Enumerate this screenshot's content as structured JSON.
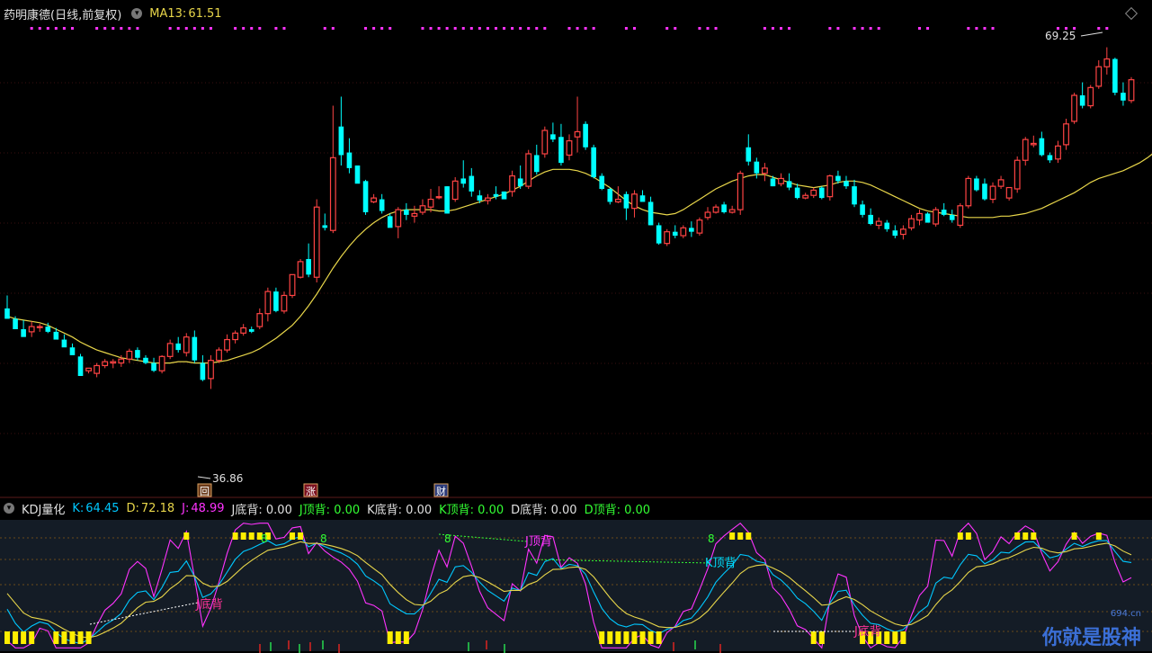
{
  "main_header": {
    "title": "药明康德(日线,前复权)",
    "ma_label": "MA13:",
    "ma_value": "61.51"
  },
  "indicator_header": {
    "name": "KDJ量化",
    "k_label": "K:",
    "k_value": "64.45",
    "d_label": "D:",
    "d_value": "72.18",
    "j_label": "J:",
    "j_value": "48.99",
    "j_bottom": "J底背: 0.00",
    "j_top": "J顶背: 0.00",
    "k_bottom": "K底背: 0.00",
    "k_top": "K顶背: 0.00",
    "d_bottom": "D底背: 0.00",
    "d_top": "D顶背: 0.00"
  },
  "annotations": {
    "high": "69.25",
    "low": "36.86",
    "badge_hui": "回",
    "badge_zhang": "涨",
    "badge_cai": "财",
    "j_bottom_div": "J底背",
    "j_top_div": "J顶背",
    "k_top_div": "K顶背",
    "j_bottom_div2": "J底背",
    "sig": "8"
  },
  "watermark": {
    "text": "你就是股神",
    "site": "694.cn"
  },
  "colors": {
    "up": "#ff4444",
    "down": "#00ffff",
    "ma": "#e8d64a",
    "k": "#00c8ff",
    "d": "#e8d64a",
    "j": "#ff33ff",
    "bg": "#000000"
  },
  "chart_data": [
    {
      "type": "candlestick",
      "title": "药明康德(日线,前复权)",
      "series_name": "MA13",
      "ylim": [
        35,
        71
      ],
      "candles": [
        [
          49.2,
          50.2,
          48.6,
          48.4
        ],
        [
          48.4,
          48.6,
          47.8,
          47.6
        ],
        [
          47.6,
          48.3,
          47.2,
          47.0
        ],
        [
          47.4,
          48.2,
          47.0,
          47.8
        ],
        [
          47.8,
          48.0,
          47.4,
          47.8
        ],
        [
          47.8,
          48.1,
          47.3,
          47.4
        ],
        [
          47.4,
          47.7,
          47.0,
          46.8
        ],
        [
          46.8,
          47.2,
          46.5,
          46.2
        ],
        [
          46.2,
          46.5,
          45.8,
          45.6
        ],
        [
          45.5,
          45.7,
          44.2,
          44.0
        ],
        [
          44.4,
          44.5,
          44.2,
          44.6
        ],
        [
          44.2,
          45.0,
          43.9,
          44.8
        ],
        [
          44.8,
          45.3,
          44.6,
          45.1
        ],
        [
          45.0,
          45.3,
          44.6,
          45.1
        ],
        [
          45.0,
          45.6,
          44.7,
          45.3
        ],
        [
          45.3,
          46.1,
          45.0,
          45.9
        ],
        [
          46.0,
          46.2,
          45.2,
          45.4
        ],
        [
          45.4,
          45.6,
          44.9,
          45.0
        ],
        [
          45.0,
          45.4,
          44.3,
          44.4
        ],
        [
          44.4,
          45.6,
          44.2,
          45.5
        ],
        [
          45.5,
          46.8,
          45.3,
          46.5
        ],
        [
          46.5,
          47.0,
          45.8,
          46.0
        ],
        [
          45.8,
          47.3,
          45.5,
          47.0
        ],
        [
          47.0,
          47.5,
          45.0,
          45.2
        ],
        [
          45.0,
          45.6,
          43.6,
          43.7
        ],
        [
          43.8,
          45.6,
          43.0,
          45.2
        ],
        [
          45.2,
          46.2,
          45.0,
          46.0
        ],
        [
          46.0,
          47.2,
          45.8,
          46.8
        ],
        [
          46.8,
          47.5,
          46.5,
          47.3
        ],
        [
          47.3,
          48.0,
          47.1,
          47.7
        ],
        [
          47.6,
          47.8,
          47.3,
          47.4
        ],
        [
          47.8,
          49.2,
          47.6,
          48.8
        ],
        [
          48.8,
          50.8,
          48.2,
          50.5
        ],
        [
          50.5,
          50.8,
          48.9,
          49.0
        ],
        [
          49.0,
          50.5,
          48.8,
          50.2
        ],
        [
          50.2,
          51.8,
          50.0,
          51.8
        ],
        [
          51.6,
          53.0,
          51.5,
          52.8
        ],
        [
          53.0,
          54.2,
          51.6,
          51.8
        ],
        [
          51.6,
          57.6,
          51.2,
          57.0
        ],
        [
          55.6,
          56.5,
          55.2,
          55.4
        ],
        [
          55.2,
          64.8,
          55.0,
          60.8
        ],
        [
          63.2,
          65.5,
          60.2,
          61.0
        ],
        [
          61.2,
          62.3,
          59.6,
          60.0
        ],
        [
          60.2,
          60.2,
          59.6,
          58.8
        ],
        [
          59.0,
          59.1,
          56.4,
          56.6
        ],
        [
          57.4,
          58.0,
          57.3,
          57.7
        ],
        [
          57.6,
          58.0,
          56.5,
          56.7
        ],
        [
          56.3,
          56.5,
          55.6,
          55.4
        ],
        [
          55.5,
          57.0,
          54.6,
          56.8
        ],
        [
          56.8,
          57.3,
          56.0,
          56.4
        ],
        [
          56.3,
          57.1,
          55.8,
          56.5
        ],
        [
          56.6,
          57.6,
          56.4,
          57.1
        ],
        [
          57.0,
          58.4,
          56.6,
          57.6
        ],
        [
          57.8,
          58.6,
          57.6,
          57.8
        ],
        [
          58.6,
          58.6,
          56.5,
          56.5
        ],
        [
          57.6,
          59.3,
          57.4,
          59.0
        ],
        [
          59.2,
          60.6,
          58.5,
          58.8
        ],
        [
          59.4,
          60.0,
          57.8,
          58.2
        ],
        [
          57.9,
          58.3,
          57.3,
          57.5
        ],
        [
          57.5,
          58.0,
          57.2,
          57.7
        ],
        [
          58.0,
          58.6,
          57.6,
          57.8
        ],
        [
          58.2,
          58.2,
          57.6,
          57.6
        ],
        [
          58.2,
          59.8,
          57.8,
          59.4
        ],
        [
          59.2,
          60.2,
          58.4,
          58.6
        ],
        [
          58.6,
          61.4,
          58.4,
          61.1
        ],
        [
          61.0,
          61.8,
          59.5,
          59.7
        ],
        [
          61.1,
          63.2,
          60.8,
          62.9
        ],
        [
          62.6,
          63.5,
          62.0,
          62.2
        ],
        [
          62.4,
          63.4,
          60.2,
          60.4
        ],
        [
          61.0,
          62.6,
          60.6,
          62.1
        ],
        [
          62.4,
          65.5,
          61.2,
          62.8
        ],
        [
          63.4,
          63.6,
          61.4,
          61.6
        ],
        [
          61.6,
          61.8,
          59.2,
          59.3
        ],
        [
          59.4,
          59.6,
          58.3,
          58.4
        ],
        [
          58.4,
          58.5,
          57.2,
          57.4
        ],
        [
          57.4,
          58.6,
          57.3,
          57.6
        ],
        [
          58.0,
          58.2,
          56.0,
          56.9
        ],
        [
          56.9,
          58.3,
          56.2,
          58.0
        ],
        [
          57.9,
          58.3,
          57.6,
          57.4
        ],
        [
          57.4,
          57.8,
          55.6,
          55.6
        ],
        [
          55.6,
          55.8,
          54.1,
          54.2
        ],
        [
          54.2,
          55.3,
          54.0,
          55.1
        ],
        [
          55.1,
          55.6,
          54.6,
          54.8
        ],
        [
          54.8,
          55.6,
          54.6,
          55.4
        ],
        [
          55.4,
          55.9,
          54.7,
          55.1
        ],
        [
          55.0,
          56.2,
          54.8,
          56.0
        ],
        [
          56.2,
          57.0,
          56.0,
          56.6
        ],
        [
          56.6,
          57.2,
          56.5,
          57.0
        ],
        [
          57.2,
          57.4,
          56.5,
          56.6
        ],
        [
          56.6,
          57.1,
          56.5,
          56.8
        ],
        [
          56.8,
          59.8,
          56.4,
          59.6
        ],
        [
          61.6,
          62.6,
          60.2,
          60.5
        ],
        [
          60.5,
          60.8,
          59.2,
          59.6
        ],
        [
          59.6,
          60.4,
          59.0,
          60.0
        ],
        [
          59.2,
          59.4,
          58.6,
          58.6
        ],
        [
          58.8,
          59.6,
          58.6,
          59.2
        ],
        [
          59.0,
          59.6,
          58.3,
          58.5
        ],
        [
          58.5,
          58.8,
          57.6,
          57.7
        ],
        [
          57.7,
          58.1,
          57.6,
          57.9
        ],
        [
          57.9,
          58.5,
          57.7,
          58.3
        ],
        [
          58.5,
          58.6,
          57.6,
          57.7
        ],
        [
          57.8,
          59.5,
          57.5,
          59.4
        ],
        [
          59.4,
          59.8,
          58.8,
          59.0
        ],
        [
          59.0,
          59.4,
          58.4,
          58.6
        ],
        [
          58.6,
          59.1,
          57.0,
          57.2
        ],
        [
          57.2,
          57.5,
          56.2,
          56.4
        ],
        [
          56.4,
          56.9,
          55.6,
          55.7
        ],
        [
          55.6,
          56.2,
          55.3,
          55.9
        ],
        [
          55.8,
          56.0,
          55.1,
          55.3
        ],
        [
          55.2,
          55.6,
          54.6,
          54.8
        ],
        [
          54.9,
          55.6,
          54.5,
          55.3
        ],
        [
          55.4,
          56.4,
          55.2,
          56.1
        ],
        [
          56.0,
          56.8,
          55.6,
          56.5
        ],
        [
          56.5,
          56.6,
          55.8,
          55.8
        ],
        [
          55.7,
          57.0,
          55.5,
          56.8
        ],
        [
          56.8,
          57.3,
          56.3,
          56.4
        ],
        [
          56.4,
          56.8,
          55.8,
          56.0
        ],
        [
          55.6,
          57.3,
          55.4,
          57.1
        ],
        [
          57.1,
          59.4,
          56.9,
          59.2
        ],
        [
          59.2,
          59.4,
          58.2,
          58.3
        ],
        [
          58.8,
          59.2,
          57.5,
          57.6
        ],
        [
          57.6,
          58.9,
          57.3,
          58.6
        ],
        [
          58.6,
          59.4,
          58.4,
          59.1
        ],
        [
          57.7,
          58.5,
          57.5,
          58.5
        ],
        [
          58.4,
          60.9,
          58.1,
          60.6
        ],
        [
          60.6,
          62.4,
          60.2,
          62.2
        ],
        [
          61.8,
          62.5,
          61.6,
          61.9
        ],
        [
          62.3,
          62.8,
          60.9,
          61.0
        ],
        [
          61.0,
          61.2,
          60.4,
          60.6
        ],
        [
          60.7,
          62.1,
          60.4,
          61.7
        ],
        [
          61.8,
          63.8,
          61.4,
          63.4
        ],
        [
          63.6,
          65.8,
          63.4,
          65.6
        ],
        [
          65.6,
          66.6,
          64.6,
          64.8
        ],
        [
          64.8,
          66.4,
          64.6,
          66.2
        ],
        [
          66.3,
          68.3,
          66.1,
          67.8
        ],
        [
          67.8,
          69.3,
          67.2,
          68.4
        ],
        [
          68.4,
          68.5,
          65.6,
          65.8
        ],
        [
          65.8,
          66.6,
          64.8,
          65.2
        ],
        [
          65.2,
          67.0,
          65.0,
          66.8
        ]
      ],
      "ma13": [
        48.6,
        48.4,
        48.3,
        48.2,
        48.1,
        47.9,
        47.6,
        47.3,
        47.0,
        46.6,
        46.3,
        46.0,
        45.8,
        45.6,
        45.4,
        45.3,
        45.2,
        45.1,
        45.0,
        45.0,
        45.0,
        45.1,
        45.1,
        45.0,
        45.0,
        45.0,
        45.1,
        45.2,
        45.4,
        45.6,
        45.8,
        46.1,
        46.5,
        46.9,
        47.4,
        47.9,
        48.6,
        49.4,
        50.3,
        51.3,
        52.3,
        53.2,
        54.0,
        54.7,
        55.3,
        55.8,
        56.2,
        56.5,
        56.7,
        56.8,
        56.8,
        56.8,
        56.8,
        56.7,
        56.7,
        56.8,
        57.0,
        57.2,
        57.4,
        57.6,
        57.8,
        58.0,
        58.3,
        58.6,
        59.0,
        59.4,
        59.7,
        59.9,
        59.9,
        59.9,
        59.8,
        59.6,
        59.3,
        58.9,
        58.5,
        58.0,
        57.5,
        57.1,
        56.8,
        56.6,
        56.5,
        56.4,
        56.5,
        56.8,
        57.2,
        57.6,
        58.0,
        58.4,
        58.7,
        59.0,
        59.2,
        59.4,
        59.5,
        59.5,
        59.3,
        59.1,
        58.9,
        58.7,
        58.6,
        58.5,
        58.6,
        58.7,
        58.9,
        59.0,
        59.0,
        58.9,
        58.7,
        58.4,
        58.1,
        57.8,
        57.5,
        57.2,
        56.9,
        56.7,
        56.6,
        56.5,
        56.4,
        56.3,
        56.2,
        56.2,
        56.2,
        56.2,
        56.3,
        56.3,
        56.4,
        56.5,
        56.7,
        56.9,
        57.2,
        57.5,
        57.8,
        58.1,
        58.5,
        58.9,
        59.2,
        59.4,
        59.6,
        59.8,
        60.1,
        60.4,
        60.8,
        61.3,
        61.9,
        62.6,
        63.3,
        63.9,
        64.3,
        64.6
      ]
    },
    {
      "type": "line",
      "title": "KDJ量化",
      "series": [
        {
          "name": "K",
          "value": 64.45
        },
        {
          "name": "D",
          "value": 72.18
        },
        {
          "name": "J",
          "value": 48.99
        }
      ]
    }
  ]
}
